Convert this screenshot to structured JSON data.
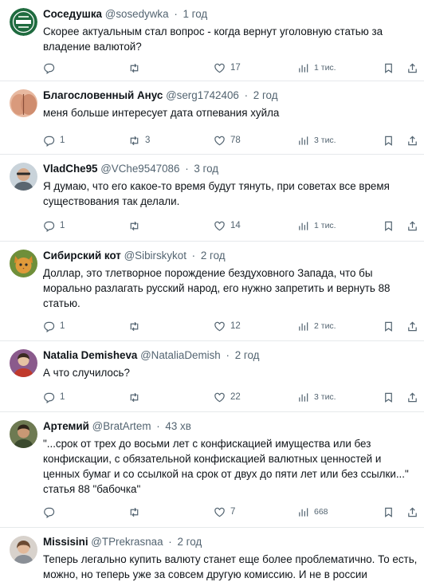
{
  "tweets": [
    {
      "name": "Соседушка",
      "handle": "@sosedywka",
      "time": "1 год",
      "text": "Скорее актуальным стал вопрос - когда вернут уголовную статью за владение валютой?",
      "replies": "",
      "retweets": "",
      "likes": "17",
      "views": "1 тис.",
      "avatar_icon": "logo-avatar-icon"
    },
    {
      "name": "Благословенный Анус",
      "handle": "@serg1742406",
      "time": "2 год",
      "text": "меня больше интересует дата отпевания хуйла",
      "replies": "1",
      "retweets": "3",
      "likes": "78",
      "views": "3 тис.",
      "avatar_icon": "peach-avatar-icon"
    },
    {
      "name": "VladChe95",
      "handle": "@VChe9547086",
      "time": "3 год",
      "text": "Я думаю, что его какое-то время будут тянуть, при советах все время существования так делали.",
      "replies": "1",
      "retweets": "",
      "likes": "14",
      "views": "1 тис.",
      "avatar_icon": "person-avatar-icon"
    },
    {
      "name": "Сибирский кот",
      "handle": "@Sibirskykot",
      "time": "2 год",
      "text": "Доллар, это тлетворное порождение бездуховного Запада, что бы морально разлагать русский народ, его нужно запретить и вернуть 88 статью.",
      "replies": "1",
      "retweets": "",
      "likes": "12",
      "views": "2 тис.",
      "avatar_icon": "cat-avatar-icon"
    },
    {
      "name": "Natalia Demisheva",
      "handle": "@NataliaDemish",
      "time": "2 год",
      "text": "А что случилось?",
      "replies": "1",
      "retweets": "",
      "likes": "22",
      "views": "3 тис.",
      "avatar_icon": "photo-avatar-icon"
    },
    {
      "name": "Артемий",
      "handle": "@BratArtem",
      "time": "43 хв",
      "text": "\"...срок от трех до восьми лет с конфискацией имущества или без конфискации, с обязательной конфискацией валютных ценностей и ценных бумаг и со ссылкой на срок от двух до пяти лет или без ссылки...\" статья 88 \"бабочка\"",
      "replies": "",
      "retweets": "",
      "likes": "7",
      "views": "668",
      "avatar_icon": "man-avatar-icon"
    },
    {
      "name": "Missisini",
      "handle": "@TPrekrasnaa",
      "time": "2 год",
      "text": "Теперь легально купить валюту станет еще более проблематично. То есть, можно, но теперь уже за совсем другую комиссию. И не в россии",
      "replies": "",
      "retweets": "",
      "likes": "",
      "views": "",
      "avatar_icon": "face-avatar-icon"
    }
  ],
  "colors": {
    "text": "#0f1419",
    "secondary": "#536471",
    "divider": "#e6e9eb"
  },
  "icons": [
    "reply-icon",
    "retweet-icon",
    "like-icon",
    "views-icon",
    "bookmark-icon",
    "share-icon"
  ]
}
